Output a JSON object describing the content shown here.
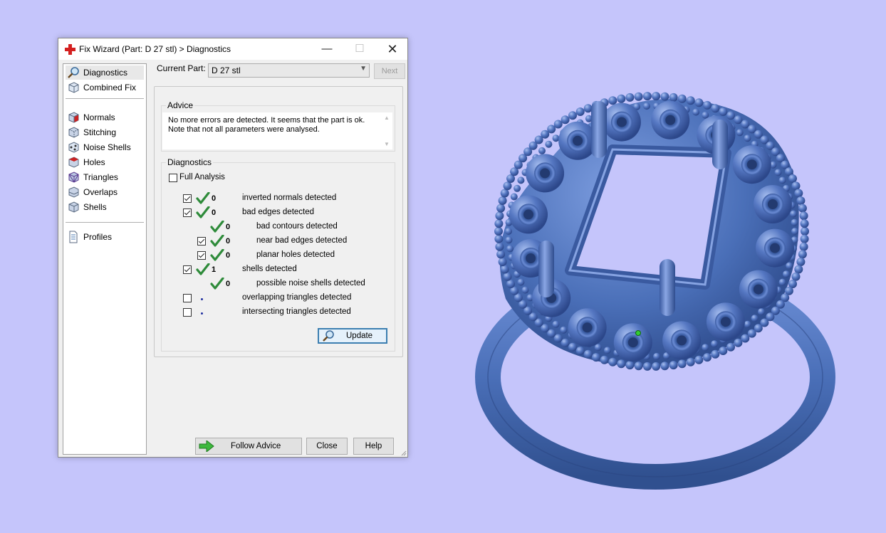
{
  "window": {
    "title": "Fix Wizard (Part: D 27 stl) > Diagnostics",
    "minimize_glyph": "—",
    "maximize_glyph": "☐",
    "close_glyph": "✕"
  },
  "nav": {
    "items": [
      {
        "label": "Diagnostics",
        "icon": "magnifier-icon",
        "selected": true
      },
      {
        "label": "Combined Fix",
        "icon": "combined-fix-cube-icon"
      },
      {
        "label": "Normals",
        "icon": "normals-cube-icon"
      },
      {
        "label": "Stitching",
        "icon": "stitching-cube-icon"
      },
      {
        "label": "Noise Shells",
        "icon": "noise-shells-icon"
      },
      {
        "label": "Holes",
        "icon": "holes-cube-icon"
      },
      {
        "label": "Triangles",
        "icon": "triangles-cube-icon"
      },
      {
        "label": "Overlaps",
        "icon": "overlaps-cube-icon"
      },
      {
        "label": "Shells",
        "icon": "shells-cube-icon"
      },
      {
        "label": "Profiles",
        "icon": "profiles-document-icon"
      }
    ]
  },
  "toolbar": {
    "current_part_label": "Current Part:",
    "current_part_value": "D 27 stl",
    "next_label": "Next"
  },
  "advice": {
    "title": "Advice",
    "text": "No more errors are detected. It seems that the part is ok. Note that not all parameters were analysed."
  },
  "diagnostics": {
    "title": "Diagnostics",
    "full_analysis_label": "Full Analysis",
    "full_analysis_checked": false,
    "rows": [
      {
        "checkbox": true,
        "checked": true,
        "status": "ok",
        "count": "0",
        "label": "inverted normals detected",
        "indent": 0
      },
      {
        "checkbox": true,
        "checked": true,
        "status": "ok",
        "count": "0",
        "label": "bad edges detected",
        "indent": 0
      },
      {
        "checkbox": false,
        "checked": false,
        "status": "ok",
        "count": "0",
        "label": "bad contours detected",
        "indent": 1
      },
      {
        "checkbox": true,
        "checked": true,
        "status": "ok",
        "count": "0",
        "label": "near bad edges detected",
        "indent": 1
      },
      {
        "checkbox": true,
        "checked": true,
        "status": "ok",
        "count": "0",
        "label": "planar holes detected",
        "indent": 1
      },
      {
        "checkbox": true,
        "checked": true,
        "status": "ok",
        "count": "1",
        "label": "shells detected",
        "indent": 0
      },
      {
        "checkbox": false,
        "checked": false,
        "status": "ok",
        "count": "0",
        "label": "possible noise shells detected",
        "indent": 1
      },
      {
        "checkbox": true,
        "checked": false,
        "status": "none",
        "count": "",
        "label": "overlapping triangles detected",
        "indent": 0
      },
      {
        "checkbox": true,
        "checked": false,
        "status": "none",
        "count": "",
        "label": "intersecting triangles detected",
        "indent": 0
      }
    ],
    "update_label": "Update"
  },
  "footer": {
    "follow_advice_label": "Follow Advice",
    "close_label": "Close",
    "help_label": "Help"
  },
  "colors": {
    "viewport_background": "#c5c5fb",
    "model": "#4a6fb8",
    "check_green": "#2e8b3a",
    "accent_blue": "#3c7fb1"
  }
}
